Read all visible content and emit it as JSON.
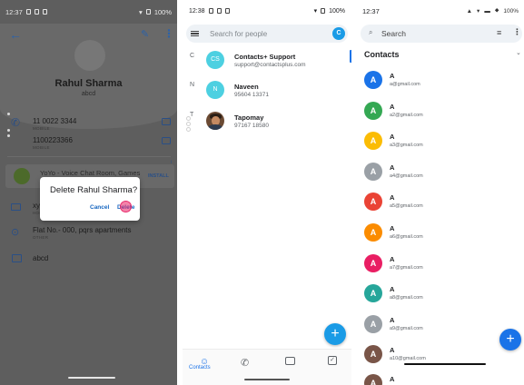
{
  "panel1": {
    "status": {
      "time": "12:37",
      "battery": "100%"
    },
    "contact": {
      "name": "Rahul Sharma",
      "subtitle": "abcd"
    },
    "phones": [
      {
        "number": "11 0022 3344",
        "label": "MOBILE"
      },
      {
        "number": "1100223366",
        "label": "MOBILE"
      }
    ],
    "ad": {
      "text": "YoYo - Voice Chat Room, Games",
      "action": "INSTALL",
      "info": "i"
    },
    "email": {
      "value": "xyz",
      "label": "HOME"
    },
    "address": {
      "value": "Flat No.- 000, pqrs apartments",
      "label": "OTHER"
    },
    "note": "abcd",
    "dialog": {
      "title": "Delete Rahul Sharma?",
      "cancel": "Cancel",
      "delete": "Delete"
    }
  },
  "panel2": {
    "status": {
      "time": "12:38",
      "battery": "100%"
    },
    "search": {
      "placeholder": "Search for people"
    },
    "user_initial": "C",
    "contacts": [
      {
        "letter": "C",
        "avatar": "CS",
        "name": "Contacts+ Support",
        "sub": "support@contactsplus.com",
        "color": "#4dd0e1"
      },
      {
        "letter": "N",
        "avatar": "N",
        "name": "Naveen",
        "sub": "95604 13371",
        "color": "#4dd0e1"
      },
      {
        "letter": "T",
        "avatar": "",
        "name": "Tapomay",
        "sub": "97167 18580",
        "color": "#6b4a33"
      }
    ],
    "fab": "+",
    "nav": {
      "contacts_label": "Contacts"
    }
  },
  "panel3": {
    "status": {
      "time": "12:37",
      "battery": "100%"
    },
    "search": {
      "placeholder": "Search"
    },
    "section_title": "Contacts",
    "contacts": [
      {
        "initial": "A",
        "name": "A",
        "email": "a@gmail.com",
        "color": "#1a73e8"
      },
      {
        "initial": "A",
        "name": "A",
        "email": "a2@gmail.com",
        "color": "#34a853"
      },
      {
        "initial": "A",
        "name": "A",
        "email": "a3@gmail.com",
        "color": "#fbbc04"
      },
      {
        "initial": "A",
        "name": "A",
        "email": "a4@gmail.com",
        "color": "#9aa0a6"
      },
      {
        "initial": "A",
        "name": "A",
        "email": "a5@gmail.com",
        "color": "#ea4335"
      },
      {
        "initial": "A",
        "name": "A",
        "email": "a6@gmail.com",
        "color": "#fb8c00"
      },
      {
        "initial": "A",
        "name": "A",
        "email": "a7@gmail.com",
        "color": "#e91e63"
      },
      {
        "initial": "A",
        "name": "A",
        "email": "a8@gmail.com",
        "color": "#26a69a"
      },
      {
        "initial": "A",
        "name": "A",
        "email": "a9@gmail.com",
        "color": "#9aa0a6"
      },
      {
        "initial": "A",
        "name": "A",
        "email": "a10@gmail.com",
        "color": "#795548"
      },
      {
        "initial": "A",
        "name": "A",
        "email": "",
        "color": "#795548"
      }
    ],
    "fab": "+"
  }
}
